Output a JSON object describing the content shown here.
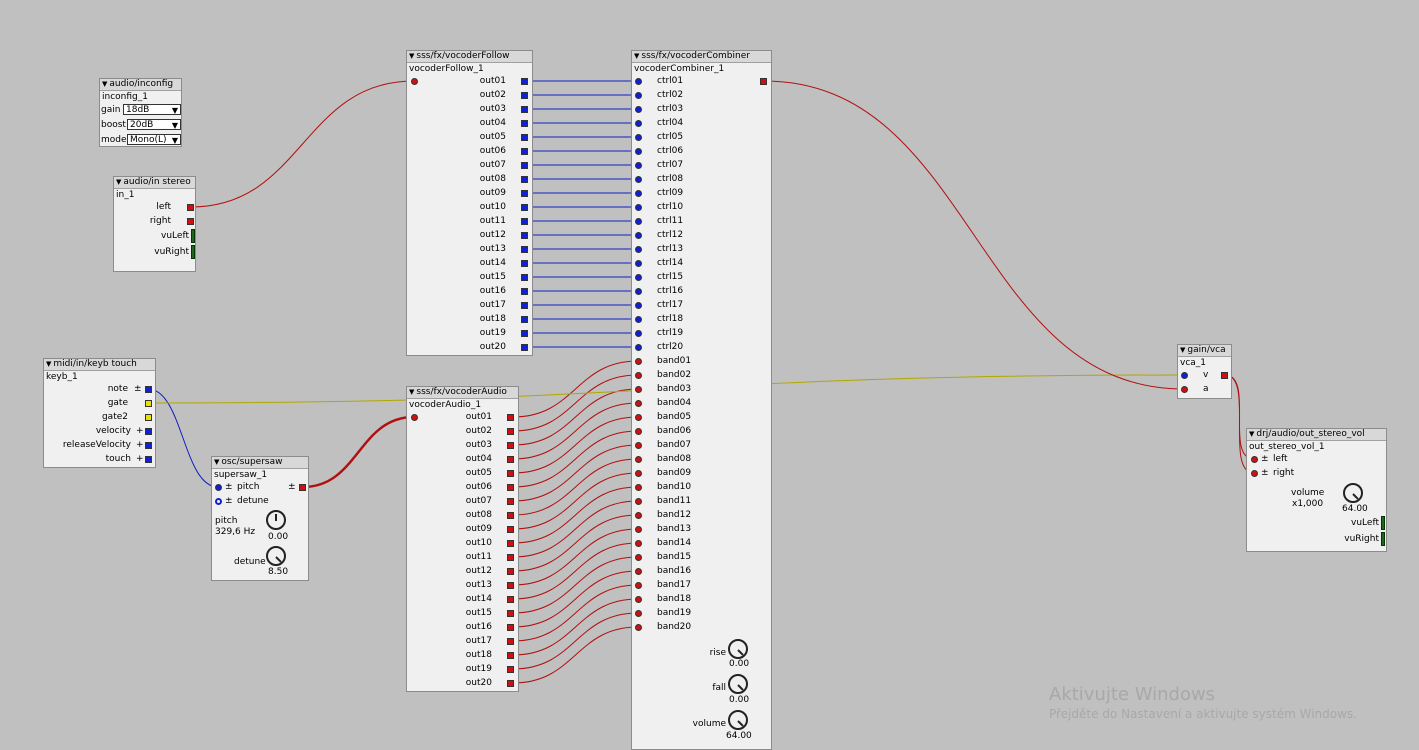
{
  "objects": {
    "inconfig": {
      "type": "audio/inconfig",
      "instance": "inconfig_1",
      "gain_label": "gain",
      "gain_value": "18dB",
      "boost_label": "boost",
      "boost_value": "20dB",
      "mode_label": "mode",
      "mode_value": "Mono(L)"
    },
    "audioin": {
      "type": "audio/in stereo",
      "instance": "in_1",
      "left": "left",
      "right": "right",
      "vuLeft": "vuLeft",
      "vuRight": "vuRight"
    },
    "follow": {
      "type": "sss/fx/vocoderFollow",
      "instance": "vocoderFollow_1",
      "outlets": [
        "out01",
        "out02",
        "out03",
        "out04",
        "out05",
        "out06",
        "out07",
        "out08",
        "out09",
        "out10",
        "out11",
        "out12",
        "out13",
        "out14",
        "out15",
        "out16",
        "out17",
        "out18",
        "out19",
        "out20"
      ]
    },
    "combiner": {
      "type": "sss/fx/vocoderCombiner",
      "instance": "vocoderCombiner_1",
      "ctrls": [
        "ctrl01",
        "ctrl02",
        "ctrl03",
        "ctrl04",
        "ctrl05",
        "ctrl06",
        "ctrl07",
        "ctrl08",
        "ctrl09",
        "ctrl10",
        "ctrl11",
        "ctrl12",
        "ctrl13",
        "ctrl14",
        "ctrl15",
        "ctrl16",
        "ctrl17",
        "ctrl18",
        "ctrl19",
        "ctrl20"
      ],
      "bands": [
        "band01",
        "band02",
        "band03",
        "band04",
        "band05",
        "band06",
        "band07",
        "band08",
        "band09",
        "band10",
        "band11",
        "band12",
        "band13",
        "band14",
        "band15",
        "band16",
        "band17",
        "band18",
        "band19",
        "band20"
      ],
      "rise_label": "rise",
      "rise_value": "0.00",
      "fall_label": "fall",
      "fall_value": "0.00",
      "volume_label": "volume",
      "volume_value": "64.00"
    },
    "vocaudio": {
      "type": "sss/fx/vocoderAudio",
      "instance": "vocoderAudio_1",
      "outlets": [
        "out01",
        "out02",
        "out03",
        "out04",
        "out05",
        "out06",
        "out07",
        "out08",
        "out09",
        "out10",
        "out11",
        "out12",
        "out13",
        "out14",
        "out15",
        "out16",
        "out17",
        "out18",
        "out19",
        "out20"
      ]
    },
    "keyb": {
      "type": "midi/in/keyb touch",
      "instance": "keyb_1",
      "note": "note",
      "gate": "gate",
      "gate2": "gate2",
      "velocity": "velocity",
      "releaseVelocity": "releaseVelocity",
      "touch": "touch",
      "pm": "±"
    },
    "supersaw": {
      "type": "osc/supersaw",
      "instance": "supersaw_1",
      "pitch": "pitch",
      "detune": "detune",
      "pm": "±",
      "pitch_param": "pitch",
      "pitch_hz": "329,6 Hz",
      "pitch_value": "0.00",
      "detune_param": "detune",
      "detune_value": "8.50"
    },
    "vca": {
      "type": "gain/vca",
      "instance": "vca_1",
      "v": "v",
      "a": "a",
      "pm": "±"
    },
    "out": {
      "type": "drj/audio/out_stereo_vol",
      "instance": "out_stereo_vol_1",
      "left": "left",
      "right": "right",
      "pm": "±",
      "volume_label": "volume",
      "volume_mult": "x1,000",
      "volume_value": "64.00",
      "vuLeft": "vuLeft",
      "vuRight": "vuRight"
    }
  },
  "colors": {
    "audio": "#b01010",
    "frac": "#1020c0",
    "bool": "#b0a800",
    "background": "#c0c0c0"
  },
  "watermark": {
    "title": "Aktivujte Windows",
    "subtitle": "Přejděte do Nastavení a aktivujte systém Windows."
  }
}
